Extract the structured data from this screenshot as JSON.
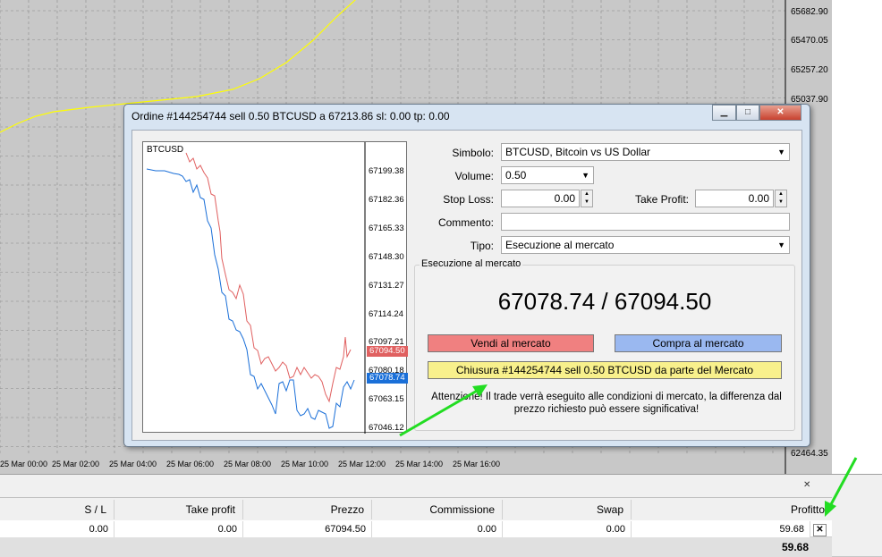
{
  "bg_chart": {
    "price_labels": [
      "65682.90",
      "65470.05",
      "65257.20",
      "65037.90",
      "62464.35"
    ],
    "time_labels": [
      "25 Mar 00:00",
      "25 Mar 02:00",
      "25 Mar 04:00",
      "25 Mar 06:00",
      "25 Mar 08:00",
      "25 Mar 10:00",
      "25 Mar 12:00",
      "25 Mar 14:00",
      "25 Mar 16:00"
    ],
    "line_color": "#ffff00"
  },
  "dialog": {
    "title": "Ordine #144254744 sell 0.50 BTCUSD a 67213.86 sl: 0.00 tp: 0.00",
    "btn_minimize": "▁",
    "btn_maximize": "□",
    "btn_close": "✕",
    "mini_chart": {
      "symbol": "BTCUSD",
      "price_labels": [
        "67199.38",
        "67182.36",
        "67165.33",
        "67148.30",
        "67131.27",
        "67114.24",
        "67097.21",
        "67080.18",
        "67063.15",
        "67046.12"
      ],
      "ask_tag": "67094.50",
      "bid_tag": "67078.74",
      "ask_color": "#e06060",
      "bid_color": "#1a6fd8"
    },
    "form": {
      "symbol_label": "Simbolo:",
      "symbol_value": "BTCUSD, Bitcoin vs US Dollar",
      "volume_label": "Volume:",
      "volume_value": "0.50",
      "sl_label": "Stop Loss:",
      "sl_value": "0.00",
      "tp_label": "Take Profit:",
      "tp_value": "0.00",
      "comment_label": "Commento:",
      "comment_value": "",
      "type_label": "Tipo:",
      "type_value": "Esecuzione al mercato"
    },
    "exec": {
      "group_label": "Esecuzione al mercato",
      "prices": "67078.74 / 67094.50",
      "sell_button": "Vendi al mercato",
      "buy_button": "Compra al mercato",
      "close_button": "Chiusura #144254744 sell 0.50 BTCUSD da parte del Mercato",
      "warning": "Attenzione! Il trade verrà eseguito alle condizioni di mercato, la differenza dal prezzo richiesto può essere significativa!",
      "sell_color": "#f08080",
      "buy_color": "#9ab8f0",
      "close_color": "#f8f08c"
    }
  },
  "terminal": {
    "close_icon": "✕",
    "headers": [
      "S / L",
      "Take profit",
      "Prezzo",
      "Commissione",
      "Swap",
      "Profitto"
    ],
    "row": [
      "0.00",
      "0.00",
      "67094.50",
      "0.00",
      "0.00",
      "59.68"
    ],
    "row_close": "✕",
    "total": "59.68"
  }
}
